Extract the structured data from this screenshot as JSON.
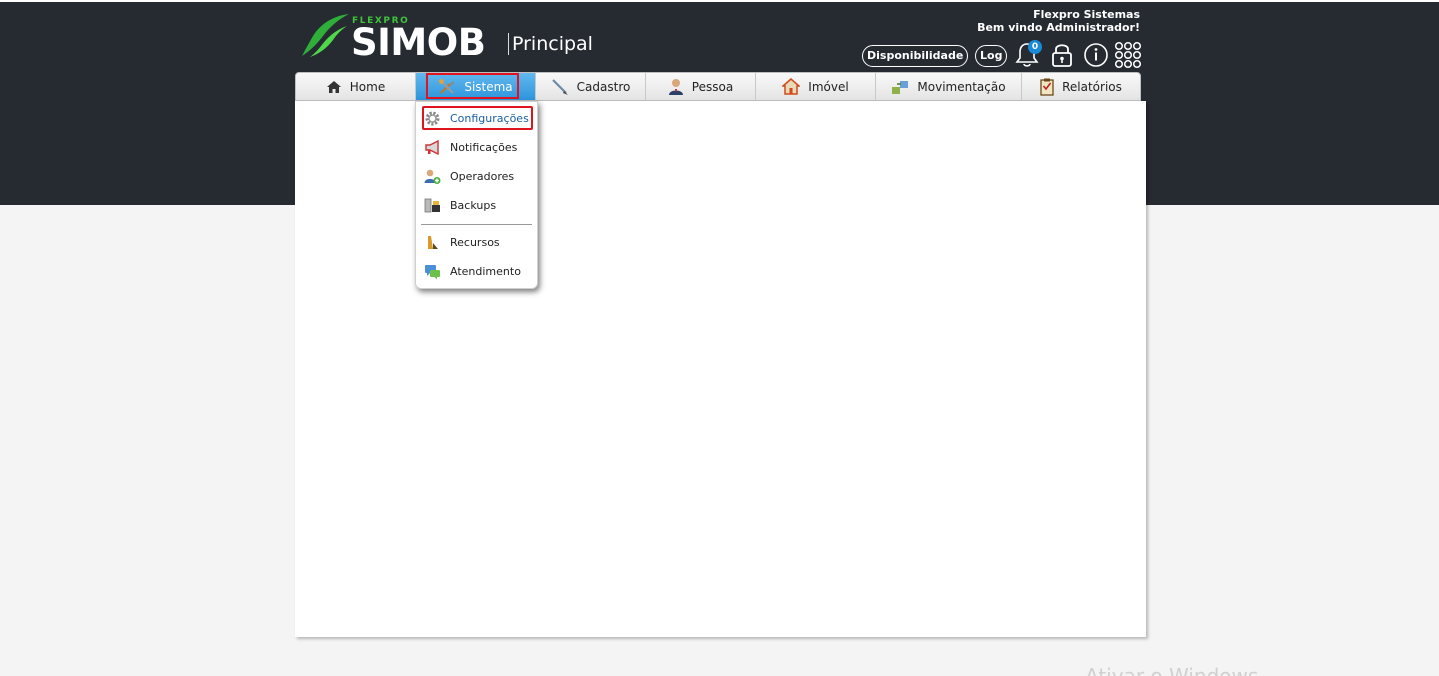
{
  "app": {
    "logo_small": "FLEXPRO",
    "logo_main": "SIMOB",
    "page_title": "Principal"
  },
  "header": {
    "company": "Flexpro Sistemas",
    "welcome": "Bem vindo Administrador!",
    "availability_button": "Disponibilidade",
    "log_button": "Log",
    "notification_count": "0",
    "icons": [
      "bell-icon",
      "lock-icon",
      "info-icon",
      "apps-grid-icon"
    ]
  },
  "nav": {
    "items": [
      {
        "label": "Home",
        "icon": "home-icon"
      },
      {
        "label": "Sistema",
        "icon": "tools-icon",
        "active": true
      },
      {
        "label": "Cadastro",
        "icon": "pen-icon"
      },
      {
        "label": "Pessoa",
        "icon": "person-icon"
      },
      {
        "label": "Imóvel",
        "icon": "house-icon"
      },
      {
        "label": "Movimentação",
        "icon": "transfer-icon"
      },
      {
        "label": "Relatórios",
        "icon": "clipboard-icon"
      }
    ]
  },
  "dropdown": {
    "items": [
      {
        "label": "Configurações",
        "icon": "gear-icon",
        "selected": true
      },
      {
        "label": "Notificações",
        "icon": "megaphone-icon"
      },
      {
        "label": "Operadores",
        "icon": "user-add-icon"
      },
      {
        "label": "Backups",
        "icon": "backup-icon"
      },
      {
        "label": "Recursos",
        "icon": "resources-icon"
      },
      {
        "label": "Atendimento",
        "icon": "chat-icon"
      }
    ]
  },
  "watermark": "Ativar o Windows",
  "colors": {
    "header_bg": "#262a31",
    "active_tab": "#2d95dd",
    "brand_green": "#3ec33a",
    "highlight": "#e0141f",
    "badge": "#1a8ad8"
  }
}
